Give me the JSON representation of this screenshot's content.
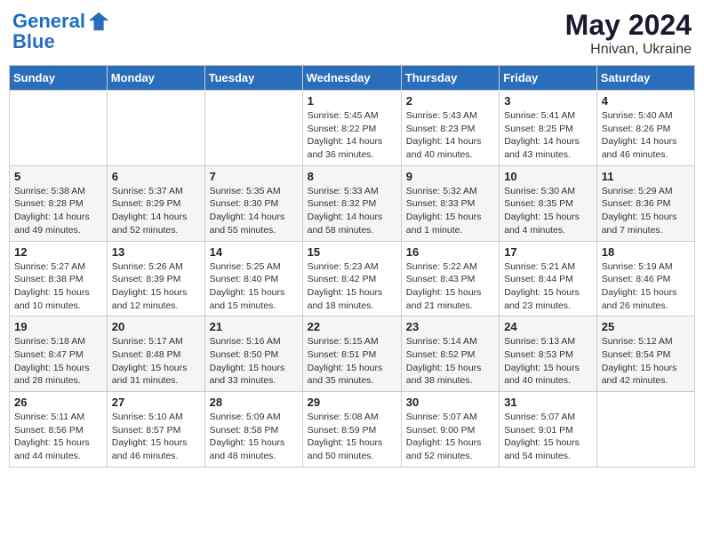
{
  "header": {
    "logo_line1": "General",
    "logo_line2": "Blue",
    "month_year": "May 2024",
    "location": "Hnivan, Ukraine"
  },
  "weekdays": [
    "Sunday",
    "Monday",
    "Tuesday",
    "Wednesday",
    "Thursday",
    "Friday",
    "Saturday"
  ],
  "weeks": [
    [
      {
        "day": "",
        "sunrise": "",
        "sunset": "",
        "daylight": ""
      },
      {
        "day": "",
        "sunrise": "",
        "sunset": "",
        "daylight": ""
      },
      {
        "day": "",
        "sunrise": "",
        "sunset": "",
        "daylight": ""
      },
      {
        "day": "1",
        "sunrise": "Sunrise: 5:45 AM",
        "sunset": "Sunset: 8:22 PM",
        "daylight": "Daylight: 14 hours and 36 minutes."
      },
      {
        "day": "2",
        "sunrise": "Sunrise: 5:43 AM",
        "sunset": "Sunset: 8:23 PM",
        "daylight": "Daylight: 14 hours and 40 minutes."
      },
      {
        "day": "3",
        "sunrise": "Sunrise: 5:41 AM",
        "sunset": "Sunset: 8:25 PM",
        "daylight": "Daylight: 14 hours and 43 minutes."
      },
      {
        "day": "4",
        "sunrise": "Sunrise: 5:40 AM",
        "sunset": "Sunset: 8:26 PM",
        "daylight": "Daylight: 14 hours and 46 minutes."
      }
    ],
    [
      {
        "day": "5",
        "sunrise": "Sunrise: 5:38 AM",
        "sunset": "Sunset: 8:28 PM",
        "daylight": "Daylight: 14 hours and 49 minutes."
      },
      {
        "day": "6",
        "sunrise": "Sunrise: 5:37 AM",
        "sunset": "Sunset: 8:29 PM",
        "daylight": "Daylight: 14 hours and 52 minutes."
      },
      {
        "day": "7",
        "sunrise": "Sunrise: 5:35 AM",
        "sunset": "Sunset: 8:30 PM",
        "daylight": "Daylight: 14 hours and 55 minutes."
      },
      {
        "day": "8",
        "sunrise": "Sunrise: 5:33 AM",
        "sunset": "Sunset: 8:32 PM",
        "daylight": "Daylight: 14 hours and 58 minutes."
      },
      {
        "day": "9",
        "sunrise": "Sunrise: 5:32 AM",
        "sunset": "Sunset: 8:33 PM",
        "daylight": "Daylight: 15 hours and 1 minute."
      },
      {
        "day": "10",
        "sunrise": "Sunrise: 5:30 AM",
        "sunset": "Sunset: 8:35 PM",
        "daylight": "Daylight: 15 hours and 4 minutes."
      },
      {
        "day": "11",
        "sunrise": "Sunrise: 5:29 AM",
        "sunset": "Sunset: 8:36 PM",
        "daylight": "Daylight: 15 hours and 7 minutes."
      }
    ],
    [
      {
        "day": "12",
        "sunrise": "Sunrise: 5:27 AM",
        "sunset": "Sunset: 8:38 PM",
        "daylight": "Daylight: 15 hours and 10 minutes."
      },
      {
        "day": "13",
        "sunrise": "Sunrise: 5:26 AM",
        "sunset": "Sunset: 8:39 PM",
        "daylight": "Daylight: 15 hours and 12 minutes."
      },
      {
        "day": "14",
        "sunrise": "Sunrise: 5:25 AM",
        "sunset": "Sunset: 8:40 PM",
        "daylight": "Daylight: 15 hours and 15 minutes."
      },
      {
        "day": "15",
        "sunrise": "Sunrise: 5:23 AM",
        "sunset": "Sunset: 8:42 PM",
        "daylight": "Daylight: 15 hours and 18 minutes."
      },
      {
        "day": "16",
        "sunrise": "Sunrise: 5:22 AM",
        "sunset": "Sunset: 8:43 PM",
        "daylight": "Daylight: 15 hours and 21 minutes."
      },
      {
        "day": "17",
        "sunrise": "Sunrise: 5:21 AM",
        "sunset": "Sunset: 8:44 PM",
        "daylight": "Daylight: 15 hours and 23 minutes."
      },
      {
        "day": "18",
        "sunrise": "Sunrise: 5:19 AM",
        "sunset": "Sunset: 8:46 PM",
        "daylight": "Daylight: 15 hours and 26 minutes."
      }
    ],
    [
      {
        "day": "19",
        "sunrise": "Sunrise: 5:18 AM",
        "sunset": "Sunset: 8:47 PM",
        "daylight": "Daylight: 15 hours and 28 minutes."
      },
      {
        "day": "20",
        "sunrise": "Sunrise: 5:17 AM",
        "sunset": "Sunset: 8:48 PM",
        "daylight": "Daylight: 15 hours and 31 minutes."
      },
      {
        "day": "21",
        "sunrise": "Sunrise: 5:16 AM",
        "sunset": "Sunset: 8:50 PM",
        "daylight": "Daylight: 15 hours and 33 minutes."
      },
      {
        "day": "22",
        "sunrise": "Sunrise: 5:15 AM",
        "sunset": "Sunset: 8:51 PM",
        "daylight": "Daylight: 15 hours and 35 minutes."
      },
      {
        "day": "23",
        "sunrise": "Sunrise: 5:14 AM",
        "sunset": "Sunset: 8:52 PM",
        "daylight": "Daylight: 15 hours and 38 minutes."
      },
      {
        "day": "24",
        "sunrise": "Sunrise: 5:13 AM",
        "sunset": "Sunset: 8:53 PM",
        "daylight": "Daylight: 15 hours and 40 minutes."
      },
      {
        "day": "25",
        "sunrise": "Sunrise: 5:12 AM",
        "sunset": "Sunset: 8:54 PM",
        "daylight": "Daylight: 15 hours and 42 minutes."
      }
    ],
    [
      {
        "day": "26",
        "sunrise": "Sunrise: 5:11 AM",
        "sunset": "Sunset: 8:56 PM",
        "daylight": "Daylight: 15 hours and 44 minutes."
      },
      {
        "day": "27",
        "sunrise": "Sunrise: 5:10 AM",
        "sunset": "Sunset: 8:57 PM",
        "daylight": "Daylight: 15 hours and 46 minutes."
      },
      {
        "day": "28",
        "sunrise": "Sunrise: 5:09 AM",
        "sunset": "Sunset: 8:58 PM",
        "daylight": "Daylight: 15 hours and 48 minutes."
      },
      {
        "day": "29",
        "sunrise": "Sunrise: 5:08 AM",
        "sunset": "Sunset: 8:59 PM",
        "daylight": "Daylight: 15 hours and 50 minutes."
      },
      {
        "day": "30",
        "sunrise": "Sunrise: 5:07 AM",
        "sunset": "Sunset: 9:00 PM",
        "daylight": "Daylight: 15 hours and 52 minutes."
      },
      {
        "day": "31",
        "sunrise": "Sunrise: 5:07 AM",
        "sunset": "Sunset: 9:01 PM",
        "daylight": "Daylight: 15 hours and 54 minutes."
      },
      {
        "day": "",
        "sunrise": "",
        "sunset": "",
        "daylight": ""
      }
    ]
  ]
}
